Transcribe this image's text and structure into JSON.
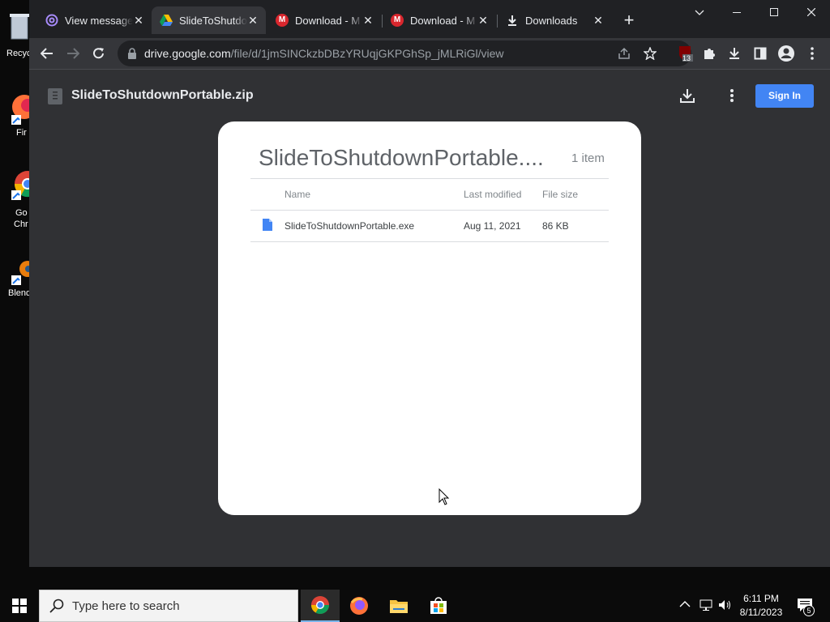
{
  "desktop": {
    "icons": [
      {
        "label": "Recycle Bin",
        "visible_text": "Recyc"
      },
      {
        "label": "Firefox",
        "visible_text": "Fir"
      },
      {
        "label": "Google Chrome",
        "visible_text_1": "Go",
        "visible_text_2": "Chr"
      },
      {
        "label": "Blender",
        "visible_text": "Blend"
      }
    ]
  },
  "browser": {
    "tabs": [
      {
        "title": "View message",
        "icon": "at-icon"
      },
      {
        "title": "SlideToShutdown",
        "icon": "google-drive-icon",
        "active": true
      },
      {
        "title": "Download - M",
        "icon": "mega-icon"
      },
      {
        "title": "Download - M",
        "icon": "mega-icon"
      },
      {
        "title": "Downloads",
        "icon": "download-icon"
      }
    ],
    "mega_letter": "M",
    "url_host": "drive.google.com",
    "url_path": "/file/d/1jmSINCkzbDBzYRUqjGKPGhSp_jMLRiGl/view",
    "extension_badge": "13"
  },
  "drive": {
    "file_name": "SlideToShutdownPortable.zip",
    "sign_in_label": "Sign In",
    "card": {
      "title": "SlideToShutdownPortable....",
      "count": "1 item",
      "columns": {
        "name": "Name",
        "modified": "Last modified",
        "size": "File size"
      },
      "rows": [
        {
          "name": "SlideToShutdownPortable.exe",
          "modified": "Aug 11, 2021",
          "size": "86 KB"
        }
      ]
    }
  },
  "taskbar": {
    "search_placeholder": "Type here to search",
    "apps": [
      "Google Chrome",
      "Firefox",
      "File Explorer",
      "Microsoft Store"
    ],
    "time": "6:11 PM",
    "date": "8/11/2023",
    "notification_count": "5"
  },
  "colors": {
    "accent": "#4285f4",
    "browser_frame": "#202124",
    "toolbar": "#35363a",
    "page_bg": "#303134"
  }
}
